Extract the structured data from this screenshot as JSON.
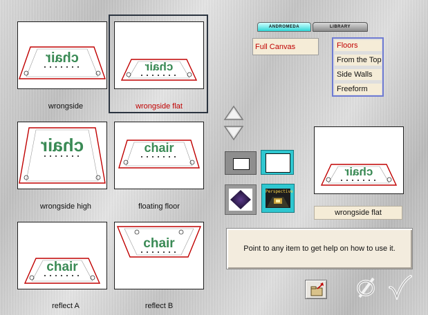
{
  "thumbnails": [
    {
      "caption": "wrongside",
      "selected": false,
      "preview_text": "chair",
      "mirrored": true,
      "variant": "high"
    },
    {
      "caption": "wrongside flat",
      "selected": true,
      "preview_text": "chair",
      "mirrored": true,
      "variant": "flat"
    },
    {
      "caption": "wrongside high",
      "selected": false,
      "preview_text": "chair",
      "mirrored": true,
      "variant": "tall"
    },
    {
      "caption": "floating floor",
      "selected": false,
      "preview_text": "chair",
      "mirrored": false,
      "variant": "float"
    },
    {
      "caption": "reflect A",
      "selected": false,
      "preview_text": "chair",
      "mirrored": false,
      "variant": "low"
    },
    {
      "caption": "reflect B",
      "selected": false,
      "preview_text": "chair",
      "mirrored": false,
      "variant": "ceiling"
    }
  ],
  "tabs": {
    "andromeda": "ANDROMEDA",
    "library": "LIBRARY"
  },
  "full_canvas": "Full Canvas",
  "category_menu": {
    "items": [
      "Floors",
      "From the Top",
      "Side Walls",
      "Freeform"
    ],
    "selected": "Floors"
  },
  "nav": {
    "up_icon": "triangle-up-icon",
    "down_icon": "triangle-down-icon"
  },
  "view_buttons": {
    "perspective_label": "Perspective"
  },
  "preview": {
    "label": "wrongside flat",
    "preview_text": "chair"
  },
  "help_text": "Point to any item to get help on how to use it.",
  "actions": {
    "open_icon": "open-folder-icon",
    "cancel_icon": "cancel-icon",
    "ok_icon": "checkmark-icon"
  },
  "colors": {
    "selected_text": "#c00000",
    "tab_active": "#2fd6d6",
    "menu_border": "#6f7bd2",
    "chair_green": "#3a8a55"
  }
}
